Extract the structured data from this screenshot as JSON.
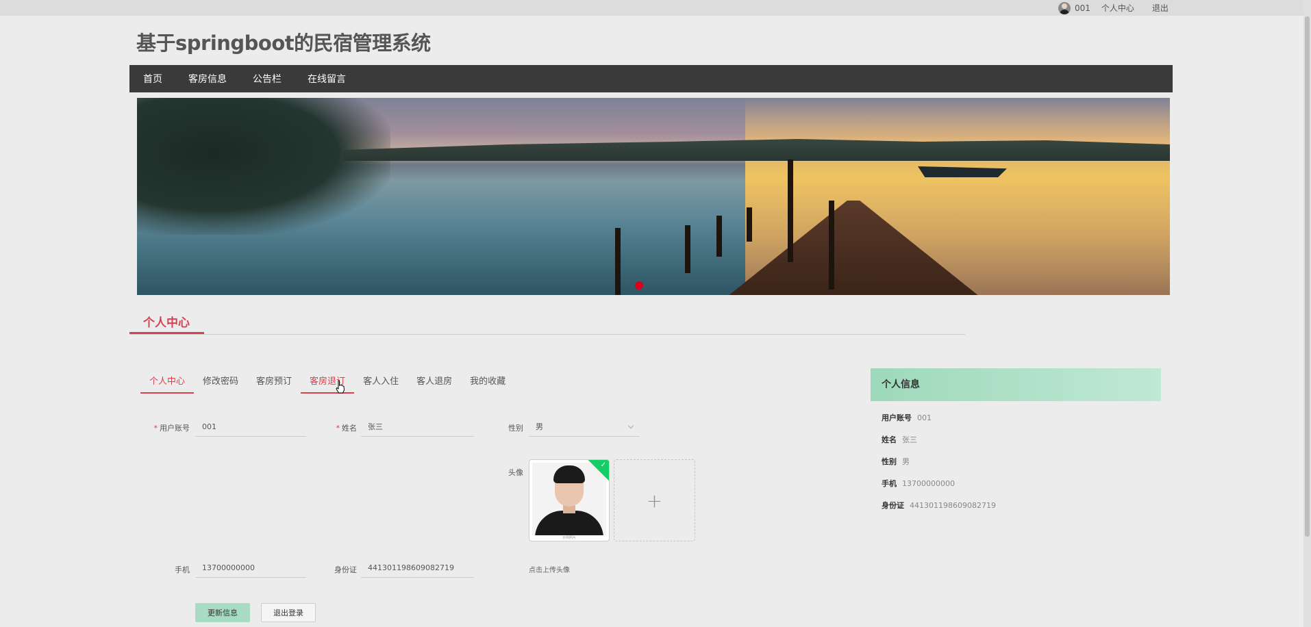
{
  "topbar": {
    "username": "001",
    "profile_link": "个人中心",
    "logout_link": "退出"
  },
  "site": {
    "title": "基于springboot的民宿管理系统"
  },
  "nav": {
    "items": [
      {
        "label": "首页"
      },
      {
        "label": "客房信息"
      },
      {
        "label": "公告栏"
      },
      {
        "label": "在线留言"
      }
    ]
  },
  "section": {
    "title": "个人中心"
  },
  "tabs": [
    {
      "label": "个人中心",
      "state": "active"
    },
    {
      "label": "修改密码",
      "state": "normal"
    },
    {
      "label": "客房预订",
      "state": "normal"
    },
    {
      "label": "客房退订",
      "state": "hover"
    },
    {
      "label": "客人入住",
      "state": "normal"
    },
    {
      "label": "客人退房",
      "state": "normal"
    },
    {
      "label": "我的收藏",
      "state": "normal"
    }
  ],
  "form": {
    "account_label": "用户账号",
    "account_value": "001",
    "name_label": "姓名",
    "name_value": "张三",
    "gender_label": "性别",
    "gender_value": "男",
    "avatar_label": "头像",
    "phone_label": "手机",
    "phone_value": "13700000000",
    "idcard_label": "身份证",
    "idcard_value": "441301198609082719",
    "upload_tip": "点击上传头像",
    "avatar_caption": "示例照片",
    "update_button": "更新信息",
    "logout_button": "退出登录",
    "required_mark": "*"
  },
  "info_card": {
    "title": "个人信息",
    "rows": [
      {
        "label": "用户账号",
        "value": "001"
      },
      {
        "label": "姓名",
        "value": "张三"
      },
      {
        "label": "性别",
        "value": "男"
      },
      {
        "label": "手机",
        "value": "13700000000"
      },
      {
        "label": "身份证",
        "value": "441301198609082719"
      }
    ]
  },
  "colors": {
    "accent": "#d9414f",
    "nav_bg": "#3a3a3a",
    "primary_button": "#a8dcc2",
    "success_badge": "#13ce66"
  },
  "icons": {
    "user_avatar": "user-avatar-icon",
    "select_arrow": "chevron-down-icon",
    "upload_plus": "plus-icon",
    "check": "check-icon",
    "carousel_indicator": "carousel-dot-icon",
    "cursor": "hand-cursor-icon"
  }
}
